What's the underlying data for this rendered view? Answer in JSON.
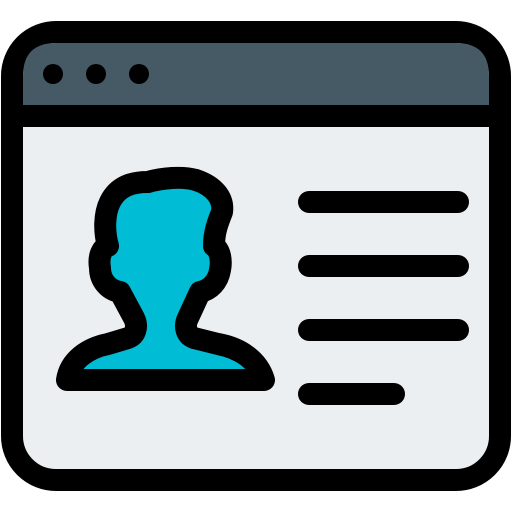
{
  "icon": {
    "name": "user-profile-browser-window-icon",
    "colors": {
      "outline": "#000000",
      "title_bar": "#455a64",
      "content_background": "#eceff1",
      "avatar_fill": "#00bcd4",
      "avatar_highlight": "#ffffff"
    },
    "title_bar_dots": 3,
    "text_lines": 4
  }
}
